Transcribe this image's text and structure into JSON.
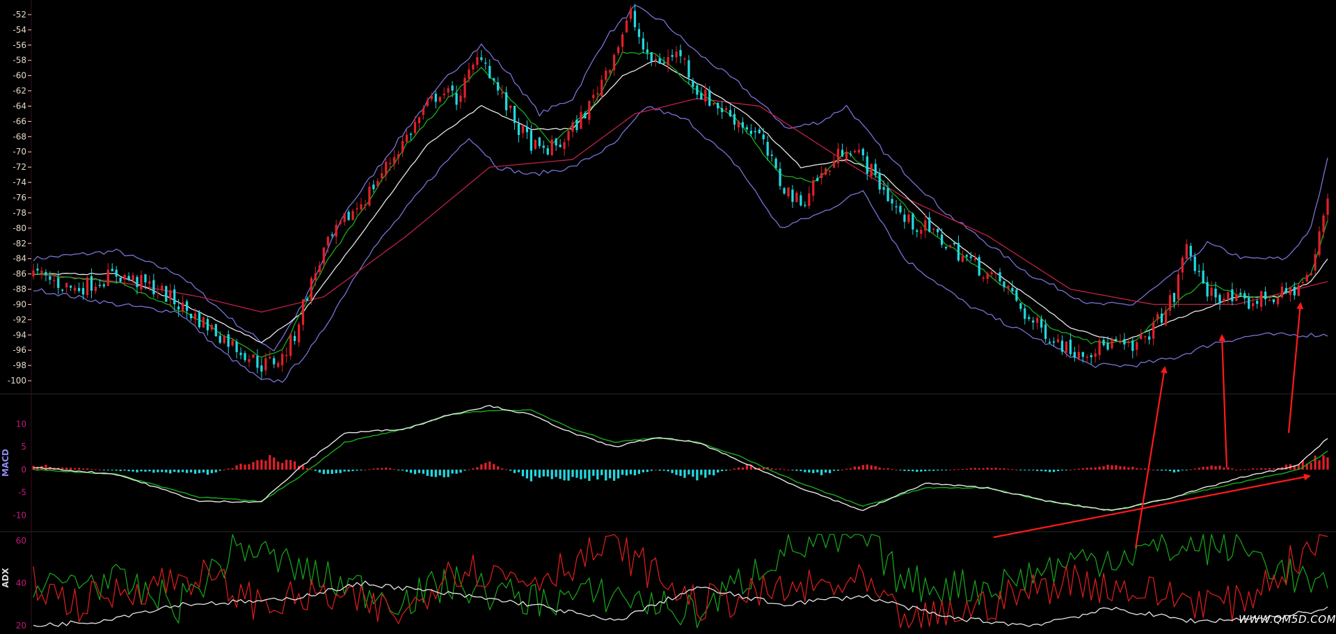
{
  "watermark": "WWW.QM5D.COM",
  "colors": {
    "background": "#000000",
    "up_candle": "#e0202a",
    "down_candle": "#22d8e0",
    "ma_fast": "#17b01a",
    "ma_mid": "#e8e8e8",
    "ma_slow": "#c0204a",
    "bollinger": "#7a72d8",
    "macd_dif": "#e8e8e8",
    "macd_dea": "#17b01a",
    "macd_pos": "#e0202a",
    "macd_neg": "#22d8e0",
    "adx_plus": "#17a018",
    "adx_minus": "#d81c1c",
    "adx_line": "#e8e8e8",
    "annotation": "#ff1a1a",
    "price_axis_text": "#e8d8c8",
    "indicator_axis_text": "#c8187c",
    "separator": "#2a2a2a"
  },
  "chart_data": [
    {
      "type": "candlestick",
      "panel": "price",
      "y_ticks": [
        "-52",
        "-54",
        "-56",
        "-58",
        "-60",
        "-62",
        "-64",
        "-66",
        "-68",
        "-70",
        "-72",
        "-74",
        "-76",
        "-78",
        "-80",
        "-82",
        "-84",
        "-86",
        "-88",
        "-90",
        "-92",
        "-94",
        "-96",
        "-98",
        "-100"
      ],
      "ylim": [
        -101,
        -51
      ],
      "close_path": [
        [
          0,
          -86
        ],
        [
          10,
          -88
        ],
        [
          20,
          -86
        ],
        [
          30,
          -88
        ],
        [
          40,
          -92
        ],
        [
          50,
          -96
        ],
        [
          55,
          -98
        ],
        [
          60,
          -97
        ],
        [
          63,
          -94
        ],
        [
          65,
          -90
        ],
        [
          70,
          -83
        ],
        [
          75,
          -79
        ],
        [
          80,
          -76
        ],
        [
          85,
          -72
        ],
        [
          90,
          -68
        ],
        [
          95,
          -64
        ],
        [
          98,
          -62
        ],
        [
          102,
          -63
        ],
        [
          108,
          -57
        ],
        [
          112,
          -62
        ],
        [
          117,
          -67
        ],
        [
          122,
          -70
        ],
        [
          127,
          -69
        ],
        [
          130,
          -67
        ],
        [
          134,
          -64
        ],
        [
          140,
          -57
        ],
        [
          144,
          -52
        ],
        [
          148,
          -58
        ],
        [
          152,
          -58
        ],
        [
          156,
          -57
        ],
        [
          160,
          -62
        ],
        [
          165,
          -64
        ],
        [
          170,
          -66
        ],
        [
          175,
          -68
        ],
        [
          180,
          -74
        ],
        [
          185,
          -77
        ],
        [
          188,
          -74
        ],
        [
          192,
          -72
        ],
        [
          196,
          -69
        ],
        [
          200,
          -71
        ],
        [
          205,
          -75
        ],
        [
          210,
          -79
        ],
        [
          215,
          -80
        ],
        [
          220,
          -82
        ],
        [
          225,
          -84
        ],
        [
          230,
          -86
        ],
        [
          235,
          -88
        ],
        [
          240,
          -92
        ],
        [
          245,
          -94
        ],
        [
          250,
          -96
        ],
        [
          255,
          -96
        ],
        [
          260,
          -95
        ],
        [
          265,
          -96
        ],
        [
          270,
          -93
        ],
        [
          275,
          -89
        ],
        [
          278,
          -82
        ],
        [
          282,
          -88
        ],
        [
          287,
          -89
        ],
        [
          292,
          -90
        ],
        [
          297,
          -89
        ],
        [
          300,
          -89
        ],
        [
          304,
          -88
        ],
        [
          308,
          -86
        ],
        [
          312,
          -76
        ]
      ],
      "ma_fast": [
        [
          0,
          -86
        ],
        [
          20,
          -87
        ],
        [
          40,
          -92
        ],
        [
          55,
          -97
        ],
        [
          60,
          -96
        ],
        [
          70,
          -85
        ],
        [
          80,
          -77
        ],
        [
          90,
          -69
        ],
        [
          100,
          -63
        ],
        [
          108,
          -59
        ],
        [
          115,
          -63
        ],
        [
          125,
          -69
        ],
        [
          135,
          -64
        ],
        [
          142,
          -57
        ],
        [
          150,
          -57
        ],
        [
          160,
          -62
        ],
        [
          170,
          -66
        ],
        [
          180,
          -73
        ],
        [
          188,
          -74
        ],
        [
          196,
          -70
        ],
        [
          205,
          -74
        ],
        [
          215,
          -80
        ],
        [
          225,
          -84
        ],
        [
          235,
          -88
        ],
        [
          245,
          -93
        ],
        [
          255,
          -95
        ],
        [
          265,
          -95
        ],
        [
          275,
          -90
        ],
        [
          282,
          -87
        ],
        [
          292,
          -89
        ],
        [
          300,
          -89
        ],
        [
          308,
          -86
        ],
        [
          312,
          -79
        ]
      ],
      "ma_mid": [
        [
          0,
          -86
        ],
        [
          20,
          -86
        ],
        [
          40,
          -91
        ],
        [
          55,
          -95
        ],
        [
          65,
          -91
        ],
        [
          80,
          -80
        ],
        [
          95,
          -69
        ],
        [
          108,
          -64
        ],
        [
          120,
          -67
        ],
        [
          130,
          -67
        ],
        [
          142,
          -60
        ],
        [
          150,
          -58
        ],
        [
          160,
          -61
        ],
        [
          172,
          -65
        ],
        [
          185,
          -72
        ],
        [
          196,
          -71
        ],
        [
          205,
          -73
        ],
        [
          220,
          -81
        ],
        [
          235,
          -87
        ],
        [
          250,
          -93
        ],
        [
          262,
          -95
        ],
        [
          275,
          -92
        ],
        [
          290,
          -89
        ],
        [
          300,
          -89
        ],
        [
          308,
          -87
        ],
        [
          312,
          -84
        ]
      ],
      "ma_slow": [
        [
          0,
          -86
        ],
        [
          20,
          -87
        ],
        [
          40,
          -89
        ],
        [
          55,
          -91
        ],
        [
          70,
          -89
        ],
        [
          90,
          -81
        ],
        [
          110,
          -72
        ],
        [
          130,
          -71
        ],
        [
          145,
          -65
        ],
        [
          160,
          -63
        ],
        [
          175,
          -64
        ],
        [
          195,
          -71
        ],
        [
          210,
          -76
        ],
        [
          230,
          -81
        ],
        [
          250,
          -88
        ],
        [
          270,
          -90
        ],
        [
          290,
          -90
        ],
        [
          312,
          -87
        ]
      ],
      "boll_upper": [
        [
          0,
          -84
        ],
        [
          20,
          -83
        ],
        [
          35,
          -86
        ],
        [
          50,
          -93
        ],
        [
          58,
          -96
        ],
        [
          65,
          -90
        ],
        [
          75,
          -78
        ],
        [
          90,
          -67
        ],
        [
          100,
          -60
        ],
        [
          108,
          -56
        ],
        [
          115,
          -60
        ],
        [
          122,
          -65
        ],
        [
          130,
          -63
        ],
        [
          138,
          -55
        ],
        [
          145,
          -51
        ],
        [
          152,
          -53
        ],
        [
          160,
          -57
        ],
        [
          170,
          -61
        ],
        [
          182,
          -67
        ],
        [
          190,
          -66
        ],
        [
          196,
          -64
        ],
        [
          205,
          -70
        ],
        [
          220,
          -78
        ],
        [
          240,
          -86
        ],
        [
          255,
          -90
        ],
        [
          265,
          -90
        ],
        [
          275,
          -86
        ],
        [
          283,
          -82
        ],
        [
          292,
          -84
        ],
        [
          302,
          -84
        ],
        [
          308,
          -80
        ],
        [
          312,
          -71
        ]
      ],
      "boll_lower": [
        [
          0,
          -88
        ],
        [
          20,
          -90
        ],
        [
          35,
          -91
        ],
        [
          45,
          -96
        ],
        [
          55,
          -100
        ],
        [
          60,
          -100
        ],
        [
          68,
          -95
        ],
        [
          80,
          -84
        ],
        [
          95,
          -74
        ],
        [
          105,
          -68
        ],
        [
          112,
          -72
        ],
        [
          120,
          -73
        ],
        [
          130,
          -72
        ],
        [
          140,
          -69
        ],
        [
          148,
          -64
        ],
        [
          158,
          -66
        ],
        [
          170,
          -72
        ],
        [
          180,
          -80
        ],
        [
          190,
          -78
        ],
        [
          200,
          -75
        ],
        [
          210,
          -84
        ],
        [
          225,
          -90
        ],
        [
          240,
          -94
        ],
        [
          255,
          -98
        ],
        [
          265,
          -98
        ],
        [
          275,
          -97
        ],
        [
          285,
          -95
        ],
        [
          295,
          -94
        ],
        [
          305,
          -94
        ],
        [
          312,
          -94
        ]
      ]
    },
    {
      "type": "line+histogram",
      "panel": "macd",
      "label": "MACD",
      "y_ticks": [
        "10",
        "5",
        "0",
        "-5",
        "-10"
      ],
      "ylim": [
        -13,
        16
      ],
      "dif": [
        [
          0,
          0.5
        ],
        [
          20,
          -1
        ],
        [
          40,
          -7
        ],
        [
          55,
          -7
        ],
        [
          65,
          1
        ],
        [
          75,
          8
        ],
        [
          90,
          9
        ],
        [
          100,
          12
        ],
        [
          110,
          14
        ],
        [
          120,
          12
        ],
        [
          130,
          8
        ],
        [
          140,
          5
        ],
        [
          150,
          7
        ],
        [
          160,
          6
        ],
        [
          170,
          2
        ],
        [
          185,
          -4
        ],
        [
          200,
          -9
        ],
        [
          215,
          -3
        ],
        [
          230,
          -4
        ],
        [
          245,
          -7
        ],
        [
          260,
          -9
        ],
        [
          275,
          -6
        ],
        [
          290,
          -2
        ],
        [
          305,
          1
        ],
        [
          312,
          7
        ]
      ],
      "dea": [
        [
          0,
          0
        ],
        [
          20,
          -1
        ],
        [
          40,
          -6
        ],
        [
          55,
          -7
        ],
        [
          65,
          -1
        ],
        [
          75,
          6
        ],
        [
          90,
          9
        ],
        [
          100,
          12
        ],
        [
          110,
          13
        ],
        [
          120,
          13
        ],
        [
          130,
          9
        ],
        [
          140,
          6
        ],
        [
          150,
          7
        ],
        [
          160,
          6
        ],
        [
          170,
          3
        ],
        [
          185,
          -3
        ],
        [
          200,
          -8
        ],
        [
          215,
          -4
        ],
        [
          230,
          -4
        ],
        [
          245,
          -7
        ],
        [
          260,
          -9
        ],
        [
          275,
          -6
        ],
        [
          290,
          -3
        ],
        [
          305,
          0
        ],
        [
          312,
          4
        ]
      ],
      "hist_envelope": [
        [
          0,
          1
        ],
        [
          25,
          -0.5
        ],
        [
          42,
          -1
        ],
        [
          50,
          1
        ],
        [
          56,
          3
        ],
        [
          62,
          2
        ],
        [
          70,
          -1
        ],
        [
          85,
          0.5
        ],
        [
          98,
          -2
        ],
        [
          110,
          1.5
        ],
        [
          120,
          -2
        ],
        [
          140,
          -2
        ],
        [
          150,
          0
        ],
        [
          160,
          -2
        ],
        [
          172,
          1
        ],
        [
          182,
          0
        ],
        [
          190,
          -1
        ],
        [
          200,
          1
        ],
        [
          212,
          -0.5
        ],
        [
          230,
          0.5
        ],
        [
          245,
          -0.5
        ],
        [
          260,
          1
        ],
        [
          275,
          -0.5
        ],
        [
          285,
          1
        ],
        [
          290,
          0
        ],
        [
          300,
          0.5
        ],
        [
          312,
          3
        ]
      ]
    },
    {
      "type": "line",
      "panel": "adx",
      "label": "ADX",
      "y_ticks": [
        "60",
        "40",
        "20"
      ],
      "ylim": [
        18,
        63
      ],
      "series": [
        {
          "values": [
            [
              0,
              35
            ],
            [
              10,
              42
            ],
            [
              20,
              40
            ],
            [
              35,
              30
            ],
            [
              50,
              58
            ],
            [
              70,
              42
            ],
            [
              90,
              32
            ],
            [
              100,
              40
            ],
            [
              120,
              32
            ],
            [
              140,
              35
            ],
            [
              160,
              25
            ],
            [
              180,
              55
            ],
            [
              200,
              62
            ],
            [
              210,
              40
            ],
            [
              230,
              38
            ],
            [
              250,
              50
            ],
            [
              270,
              56
            ],
            [
              290,
              58
            ],
            [
              312,
              35
            ]
          ]
        },
        {
          "values": [
            [
              0,
              40
            ],
            [
              10,
              30
            ],
            [
              25,
              38
            ],
            [
              40,
              44
            ],
            [
              55,
              30
            ],
            [
              70,
              34
            ],
            [
              90,
              25
            ],
            [
              100,
              48
            ],
            [
              120,
              42
            ],
            [
              140,
              58
            ],
            [
              160,
              30
            ],
            [
              180,
              36
            ],
            [
              200,
              40
            ],
            [
              210,
              20
            ],
            [
              230,
              30
            ],
            [
              250,
              42
            ],
            [
              270,
              35
            ],
            [
              290,
              30
            ],
            [
              312,
              62
            ]
          ]
        },
        {
          "values": [
            [
              0,
              20
            ],
            [
              15,
              22
            ],
            [
              35,
              30
            ],
            [
              60,
              32
            ],
            [
              80,
              40
            ],
            [
              100,
              35
            ],
            [
              120,
              30
            ],
            [
              140,
              22
            ],
            [
              160,
              38
            ],
            [
              180,
              30
            ],
            [
              200,
              34
            ],
            [
              220,
              24
            ],
            [
              240,
              20
            ],
            [
              260,
              28
            ],
            [
              280,
              22
            ],
            [
              300,
              24
            ],
            [
              312,
              28
            ]
          ]
        }
      ]
    }
  ],
  "annotations": {
    "arrows_count": 4,
    "trendline": "macd-low-rising"
  }
}
